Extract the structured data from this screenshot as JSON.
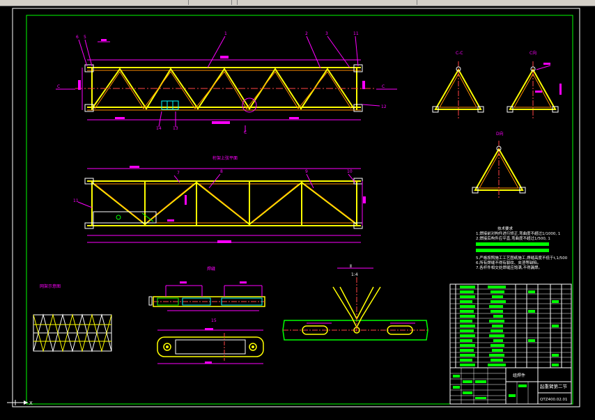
{
  "drawing": {
    "front_view": {
      "section_left": "C",
      "section_right": "C",
      "section_label": "C"
    },
    "top_view": {
      "title": "桁架上弦平面"
    },
    "section_cc": {
      "label": "C-C"
    },
    "section_cc2": {
      "label": "C向"
    },
    "section_dd": {
      "label": "D向"
    },
    "node_detail": {
      "scale": "1:4"
    },
    "weld_detail": {
      "title": "焊缝"
    },
    "connector_detail": {
      "label": "15"
    },
    "truss_grid": {
      "title": "网架示意图"
    },
    "tech_req": {
      "title": "技术要求",
      "items": [
        "1.焊接前对构件进行矫正,弯曲度不超过1/1000, 1",
        "2.焊接后构件应平直,弯曲度不超过1/500, 1",
        "3.",
        "4.",
        "5.严格按照施工工艺图纸施工,焊缝高度不低于t,1/500",
        "6.所有焊缝不得有裂纹、夹渣等缺陷。",
        "7.各杆件相交处焊缝应饱满,不得漏焊。"
      ]
    },
    "title_block": {
      "material": "组焊件",
      "name": "起重臂第二节",
      "drawing_no": "QTZ400.02.01"
    },
    "callouts": {
      "c1": "6",
      "c2": "5",
      "c3": "1",
      "c4": "2",
      "c5": "3",
      "c6": "11",
      "c7": "12",
      "c8": "14",
      "c9": "13",
      "c10": "7",
      "c11": "8",
      "c12": "9",
      "c13": "10",
      "c14": "11"
    }
  },
  "colors": {
    "truss": "#ffff00",
    "truss_orange": "#ff8c00",
    "dimension": "#ff00ff",
    "frame": "#00ff00",
    "line_white": "#ffffff",
    "text_green": "#00ff00"
  },
  "ui": {
    "ucs_icon": "ucs-icon"
  }
}
